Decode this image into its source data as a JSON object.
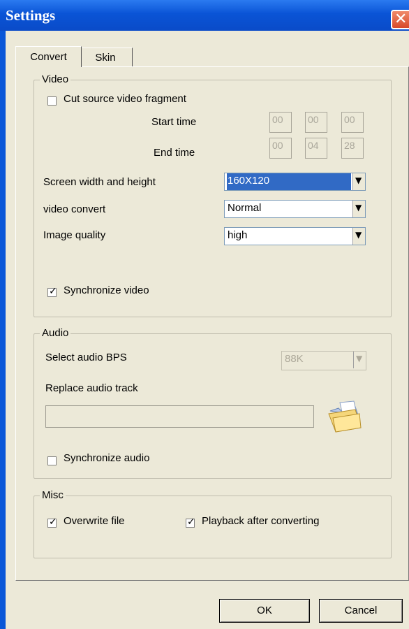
{
  "window": {
    "title": "Settings"
  },
  "tabs": [
    {
      "label": "Convert"
    },
    {
      "label": "Skin"
    }
  ],
  "video": {
    "group_label": "Video",
    "cut_fragment_label": "Cut source video fragment",
    "cut_fragment_checked": false,
    "start_time_label": "Start time",
    "start_time": [
      "00",
      "00",
      "00"
    ],
    "end_time_label": "End time",
    "end_time": [
      "00",
      "04",
      "28"
    ],
    "screen_size_label": "Screen width and height",
    "screen_size_value": "160X120",
    "video_convert_label": "video convert",
    "video_convert_value": "Normal",
    "image_quality_label": "Image quality",
    "image_quality_value": "high",
    "sync_video_label": "Synchronize video",
    "sync_video_checked": true
  },
  "audio": {
    "group_label": "Audio",
    "bps_label": "Select audio BPS",
    "bps_value": "88K",
    "replace_track_label": "Replace audio track",
    "replace_track_value": "",
    "sync_audio_label": "Synchronize audio",
    "sync_audio_checked": false
  },
  "misc": {
    "group_label": "Misc",
    "overwrite_label": "Overwrite file",
    "overwrite_checked": true,
    "playback_label": "Playback after converting",
    "playback_checked": true
  },
  "buttons": {
    "ok_label": "OK",
    "cancel_label": "Cancel"
  },
  "colors": {
    "titlebar": "#0a54d6",
    "face": "#ece9d8",
    "selection": "#316ac5"
  }
}
